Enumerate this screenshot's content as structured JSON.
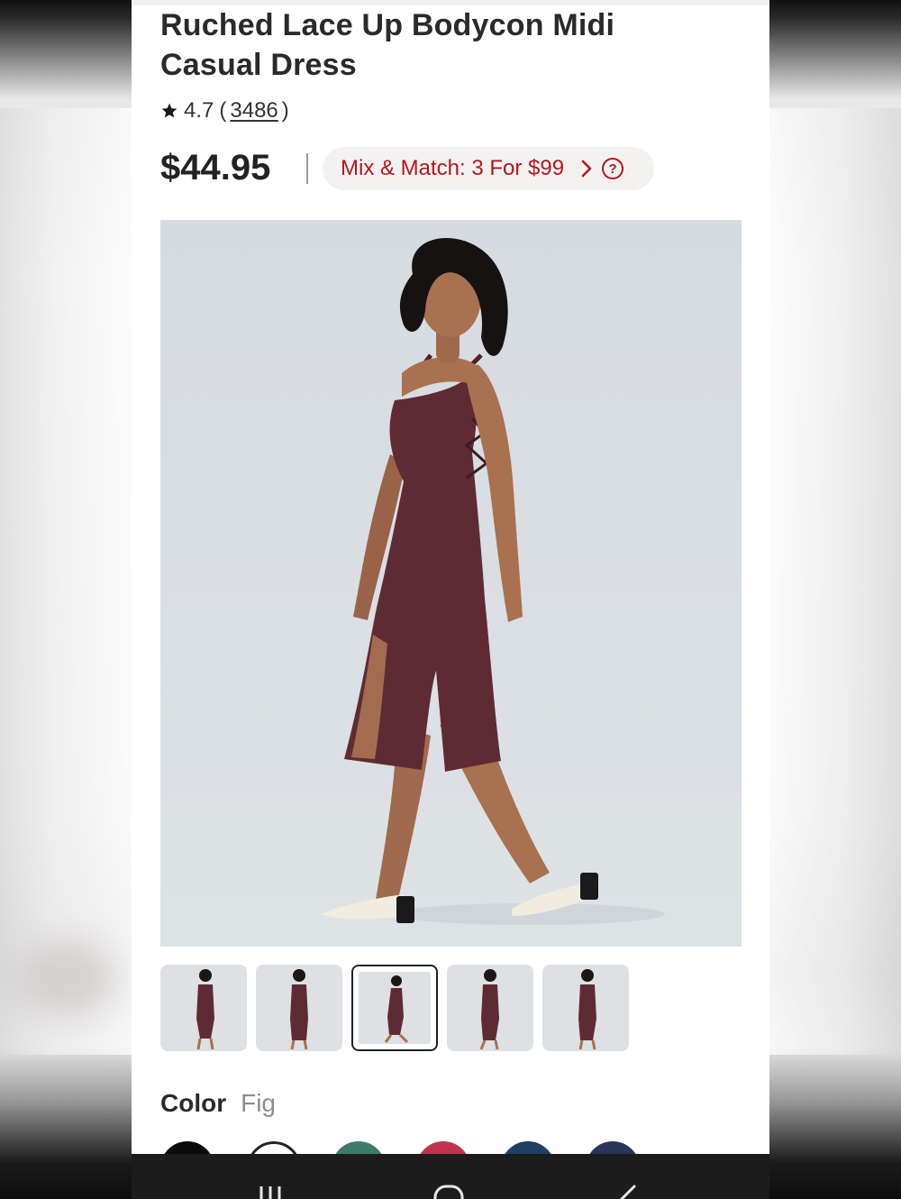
{
  "product": {
    "title": "Ruched Lace Up Bodycon Midi Casual Dress",
    "rating_value": "4.7",
    "rating_open": "(",
    "rating_count": "3486",
    "rating_close": ")",
    "price": "$44.95",
    "promo_label": "Mix & Match: 3 For $99",
    "promo_help": "?"
  },
  "gallery": {
    "thumbnails": [
      {
        "name": "back-view"
      },
      {
        "name": "front-view"
      },
      {
        "name": "side-walking-view",
        "selected": true
      },
      {
        "name": "front-slit-view"
      },
      {
        "name": "back-lace-view"
      }
    ]
  },
  "color": {
    "label": "Color",
    "selected": "Fig",
    "swatches": [
      "#0b0b0b",
      "#ffffff",
      "#3e7a6a",
      "#c2334f",
      "#1f3f63",
      "#2a3557"
    ]
  },
  "colors": {
    "accent": "#b3171e",
    "dress": "#5e2b35",
    "hero_bg": "#d9dee2"
  },
  "system_nav": {
    "icons": [
      "recent-apps-icon",
      "home-icon",
      "back-icon"
    ]
  }
}
